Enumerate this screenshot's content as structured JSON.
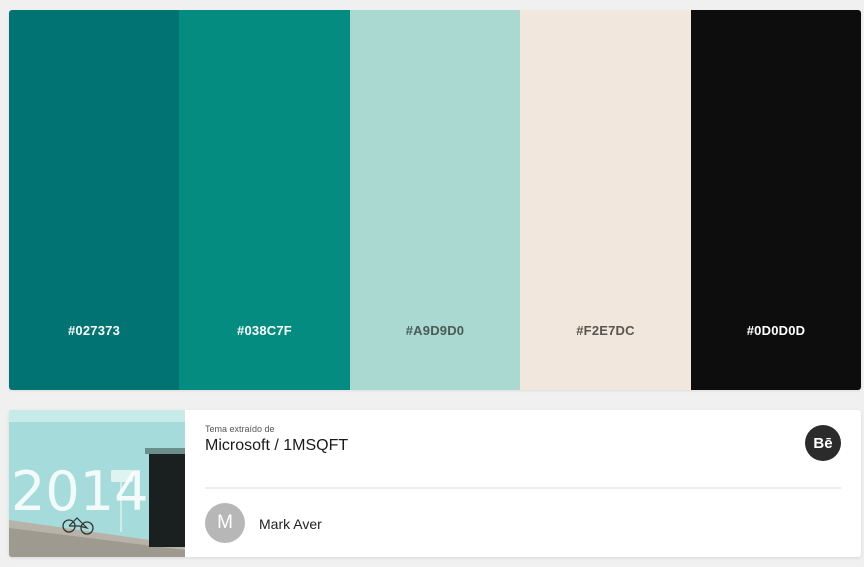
{
  "palette": {
    "swatches": [
      {
        "hex": "#027373",
        "label": "#027373",
        "text_color": "#ffffff"
      },
      {
        "hex": "#038C7F",
        "label": "#038C7F",
        "text_color": "#ffffff"
      },
      {
        "hex": "#A9D9D0",
        "label": "#A9D9D0",
        "text_color": "#4a5a57"
      },
      {
        "hex": "#F2E7DC",
        "label": "#F2E7DC",
        "text_color": "#5a5550"
      },
      {
        "hex": "#0D0D0D",
        "label": "#0D0D0D",
        "text_color": "#ffffff"
      }
    ]
  },
  "source": {
    "caption": "Tema extraído de",
    "title": "Microsoft / 1MSQFT",
    "behance_icon": "Bē",
    "thumbnail_text": "2014"
  },
  "author": {
    "initial": "M",
    "name": "Mark Aver"
  }
}
